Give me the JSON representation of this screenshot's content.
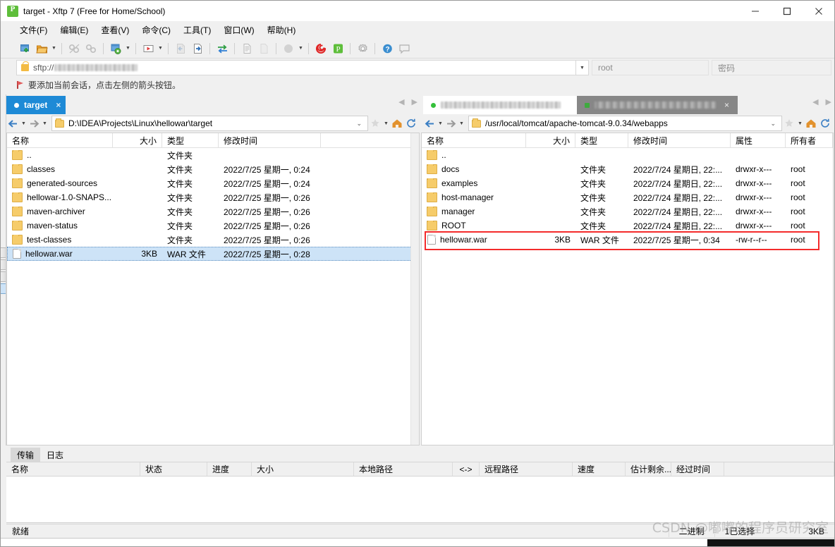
{
  "window": {
    "title": "target - Xftp 7 (Free for Home/School)",
    "app_icon": "xftp-icon",
    "minimize": "–",
    "maximize": "□",
    "close": "✕"
  },
  "menubar": [
    {
      "label": "文件(F)",
      "name": "menu-file"
    },
    {
      "label": "编辑(E)",
      "name": "menu-edit"
    },
    {
      "label": "查看(V)",
      "name": "menu-view"
    },
    {
      "label": "命令(C)",
      "name": "menu-command"
    },
    {
      "label": "工具(T)",
      "name": "menu-tools"
    },
    {
      "label": "窗口(W)",
      "name": "menu-window"
    },
    {
      "label": "帮助(H)",
      "name": "menu-help"
    }
  ],
  "loginbar": {
    "protocol": "sftp://",
    "host_redacted": true,
    "username": "root",
    "password_placeholder": "密码"
  },
  "notice": {
    "text": "要添加当前会话，点击左侧的箭头按钮。"
  },
  "left_pane": {
    "tab": {
      "label": "target",
      "close": "×"
    },
    "path": "D:\\IDEA\\Projects\\Linux\\hellowar\\target",
    "columns": [
      "名称",
      "大小",
      "类型",
      "修改时间"
    ],
    "rows": [
      {
        "icon": "folder",
        "name": "..",
        "size": "",
        "type": "文件夹",
        "modified": "",
        "selected": false
      },
      {
        "icon": "folder",
        "name": "classes",
        "size": "",
        "type": "文件夹",
        "modified": "2022/7/25 星期一, 0:24",
        "selected": false
      },
      {
        "icon": "folder",
        "name": "generated-sources",
        "size": "",
        "type": "文件夹",
        "modified": "2022/7/25 星期一, 0:24",
        "selected": false
      },
      {
        "icon": "folder",
        "name": "hellowar-1.0-SNAPS...",
        "size": "",
        "type": "文件夹",
        "modified": "2022/7/25 星期一, 0:26",
        "selected": false
      },
      {
        "icon": "folder",
        "name": "maven-archiver",
        "size": "",
        "type": "文件夹",
        "modified": "2022/7/25 星期一, 0:26",
        "selected": false
      },
      {
        "icon": "folder",
        "name": "maven-status",
        "size": "",
        "type": "文件夹",
        "modified": "2022/7/25 星期一, 0:26",
        "selected": false
      },
      {
        "icon": "folder",
        "name": "test-classes",
        "size": "",
        "type": "文件夹",
        "modified": "2022/7/25 星期一, 0:26",
        "selected": false
      },
      {
        "icon": "file",
        "name": "hellowar.war",
        "size": "3KB",
        "type": "WAR 文件",
        "modified": "2022/7/25 星期一, 0:28",
        "selected": true
      }
    ]
  },
  "right_pane": {
    "tabs": [
      {
        "label": "",
        "redacted": true,
        "state": "inactive-light",
        "dot": "green"
      },
      {
        "label": "",
        "redacted": true,
        "state": "inactive-dark",
        "dot": "greensq",
        "close": "×"
      }
    ],
    "path": "/usr/local/tomcat/apache-tomcat-9.0.34/webapps",
    "columns": [
      "名称",
      "大小",
      "类型",
      "修改时间",
      "属性",
      "所有者"
    ],
    "rows": [
      {
        "icon": "folder",
        "name": "..",
        "size": "",
        "type": "",
        "modified": "",
        "attrs": "",
        "owner": "",
        "highlight": false
      },
      {
        "icon": "folder",
        "name": "docs",
        "size": "",
        "type": "文件夹",
        "modified": "2022/7/24 星期日, 22:...",
        "attrs": "drwxr-x---",
        "owner": "root",
        "highlight": false
      },
      {
        "icon": "folder",
        "name": "examples",
        "size": "",
        "type": "文件夹",
        "modified": "2022/7/24 星期日, 22:...",
        "attrs": "drwxr-x---",
        "owner": "root",
        "highlight": false
      },
      {
        "icon": "folder",
        "name": "host-manager",
        "size": "",
        "type": "文件夹",
        "modified": "2022/7/24 星期日, 22:...",
        "attrs": "drwxr-x---",
        "owner": "root",
        "highlight": false
      },
      {
        "icon": "folder",
        "name": "manager",
        "size": "",
        "type": "文件夹",
        "modified": "2022/7/24 星期日, 22:...",
        "attrs": "drwxr-x---",
        "owner": "root",
        "highlight": false
      },
      {
        "icon": "folder",
        "name": "ROOT",
        "size": "",
        "type": "文件夹",
        "modified": "2022/7/24 星期日, 22:...",
        "attrs": "drwxr-x---",
        "owner": "root",
        "highlight": false
      },
      {
        "icon": "file",
        "name": "hellowar.war",
        "size": "3KB",
        "type": "WAR 文件",
        "modified": "2022/7/25 星期一, 0:34",
        "attrs": "-rw-r--r--",
        "owner": "root",
        "highlight": true
      }
    ],
    "highlight_color": "#f42b2b"
  },
  "transfer": {
    "tabs": [
      {
        "label": "传输",
        "active": true
      },
      {
        "label": "日志",
        "active": false
      }
    ],
    "columns": [
      "名称",
      "状态",
      "进度",
      "大小",
      "本地路径",
      "<->",
      "远程路径",
      "速度",
      "估计剩余...",
      "经过时间"
    ]
  },
  "statusbar": {
    "ready": "就绪",
    "mode": "二进制",
    "selection": "1已选择",
    "selection_size": "3KB"
  },
  "watermark": "CSDN @嘟嘟的程序员研究室"
}
